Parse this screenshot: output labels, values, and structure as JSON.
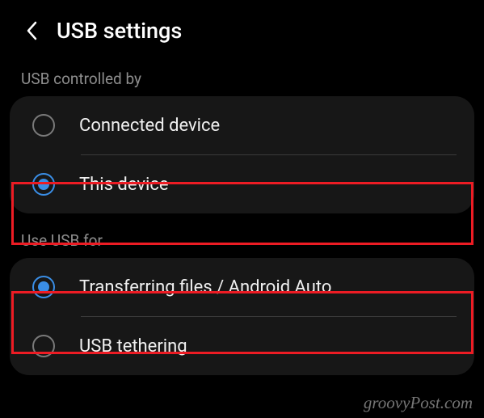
{
  "header": {
    "title": "USB settings"
  },
  "sections": {
    "controlled_by": {
      "label": "USB controlled by",
      "options": {
        "connected_device": "Connected device",
        "this_device": "This device"
      }
    },
    "use_for": {
      "label": "Use USB for",
      "options": {
        "transferring_files": "Transferring files / Android Auto",
        "usb_tethering": "USB tethering"
      }
    }
  },
  "watermark": "groovyPost.com"
}
